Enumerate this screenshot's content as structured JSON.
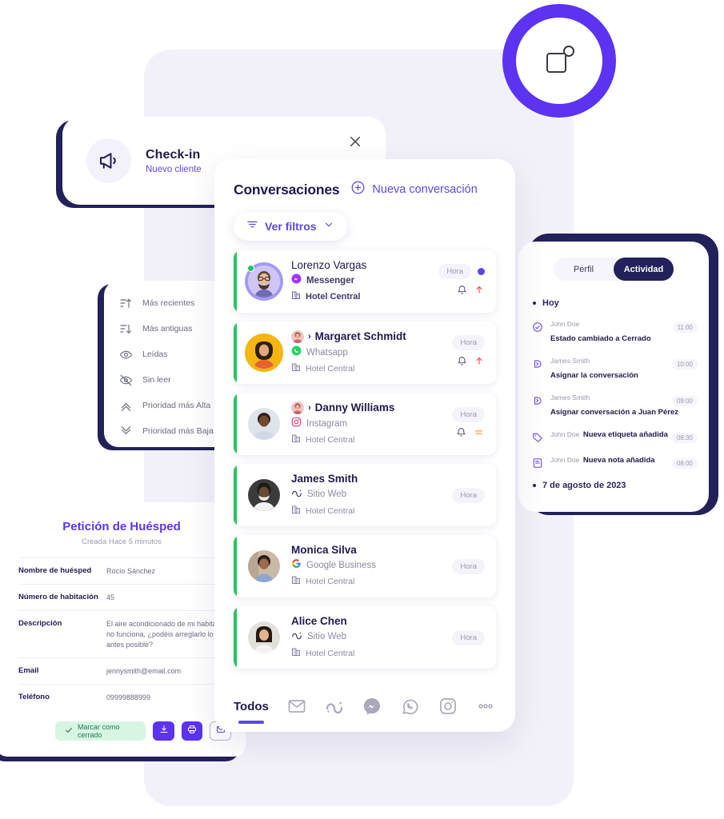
{
  "badge": {
    "icon": "notification-square-icon"
  },
  "checkin_card": {
    "icon": "megaphone-icon",
    "title": "Check-in",
    "subtitle": "Nuevo cliente"
  },
  "sort_menu": {
    "items": [
      {
        "icon": "sort-ascending-icon",
        "label": "Más recientes"
      },
      {
        "icon": "sort-descending-icon",
        "label": "Más antiguas"
      },
      {
        "icon": "eye-icon",
        "label": "Leídas"
      },
      {
        "icon": "eye-off-icon",
        "label": "Sin leer"
      },
      {
        "icon": "chevrons-up-icon",
        "label": "Prioridad más Alta"
      },
      {
        "icon": "chevrons-down-icon",
        "label": "Prioridad más Baja"
      }
    ]
  },
  "conversations_panel": {
    "title": "Conversaciones",
    "new_conversation": {
      "icon": "plus-circle-icon",
      "label": "Nueva conversación"
    },
    "filters_button": {
      "icon": "filter-icon",
      "label": "Ver filtros",
      "chevron": "chevron-down-icon"
    },
    "close_icon": "close-icon",
    "time_badge": "Hora",
    "items": [
      {
        "name": "Lorenzo Vargas",
        "channel": "Messenger",
        "channel_icon": "messenger-icon",
        "hotel": "Hotel Central",
        "hotel_icon": "building-icon",
        "time": "Hora",
        "unread": true,
        "online": true,
        "has_parent": false,
        "bold": true,
        "bell": "bell-icon",
        "priority": "high"
      },
      {
        "name": "Margaret Schmidt",
        "channel": "Whatsapp",
        "channel_icon": "whatsapp-icon",
        "hotel": "Hotel Central",
        "hotel_icon": "building-icon",
        "time": "Hora",
        "unread": false,
        "online": false,
        "has_parent": true,
        "bold": true,
        "bell": "bell-icon",
        "priority": "high"
      },
      {
        "name": "Danny Williams",
        "channel": "Instagram",
        "channel_icon": "instagram-icon",
        "hotel": "Hotel Central",
        "hotel_icon": "building-icon",
        "time": "Hora",
        "unread": false,
        "online": false,
        "has_parent": true,
        "bold": true,
        "bell": "bell-icon",
        "priority": "medium"
      },
      {
        "name": "James Smith",
        "channel": "Sitio Web",
        "channel_icon": "website-icon",
        "hotel": "Hotel Central",
        "hotel_icon": "building-icon",
        "time": "Hora",
        "unread": false,
        "online": false,
        "has_parent": false,
        "bold": true,
        "bell": "",
        "priority": "none"
      },
      {
        "name": "Monica Silva",
        "channel": "Google Business",
        "channel_icon": "google-icon",
        "hotel": "Hotel Central",
        "hotel_icon": "building-icon",
        "time": "Hora",
        "unread": false,
        "online": false,
        "has_parent": false,
        "bold": true,
        "bell": "",
        "priority": "none"
      },
      {
        "name": "Alice Chen",
        "channel": "Sitio Web",
        "channel_icon": "website-icon",
        "hotel": "Hotel Central",
        "hotel_icon": "building-icon",
        "time": "Hora",
        "unread": false,
        "online": false,
        "has_parent": false,
        "bold": true,
        "bell": "",
        "priority": "none"
      }
    ],
    "channel_bar": {
      "all_label": "Todos",
      "icons": [
        "email-icon",
        "website-icon",
        "messenger-icon",
        "whatsapp-icon",
        "instagram-icon",
        "more-icon"
      ]
    }
  },
  "activity_panel": {
    "tabs": [
      {
        "label": "Perfil",
        "active": false
      },
      {
        "label": "Actividad",
        "active": true
      }
    ],
    "today_label": "Hoy",
    "entries": [
      {
        "icon": "check-circle-icon",
        "user": "John Doe",
        "action": "Estado cambiado a Cerrado",
        "time": "11:00"
      },
      {
        "icon": "assign-icon",
        "user": "James Smith",
        "action": "Asignar la conversación",
        "time": "10:00"
      },
      {
        "icon": "assign-icon",
        "user": "James Smith",
        "action": "Asignar conversación a Juan Pérez",
        "time": "09:00"
      },
      {
        "icon": "tag-icon",
        "user": "John Doe",
        "action": "Nueva etiqueta añadida",
        "time": "08:30"
      },
      {
        "icon": "note-icon",
        "user": "John Doe",
        "action": "Nueva nota añadida",
        "time": "08:00"
      }
    ],
    "past_date_label": "7 de agosto de 2023"
  },
  "guest_request": {
    "title": "Petición de Huésped",
    "subtitle": "Creada Hace 5 minutos",
    "fields": [
      {
        "key": "Nombre de huésped",
        "value": "Rocío Sánchez"
      },
      {
        "key": "Número de habitación",
        "value": "45"
      },
      {
        "key": "Descripción",
        "value": "El aire acondicionado de mi habitación no funciona, ¿podéis arreglarlo lo antes posible?"
      },
      {
        "key": "Email",
        "value": "jennysmith@email.com"
      },
      {
        "key": "Teléfono",
        "value": "09999888999"
      }
    ],
    "close_button": {
      "icon": "check-icon",
      "label": "Marcar como cerrado"
    },
    "action_buttons": [
      "download-icon",
      "print-icon",
      "mail-icon"
    ]
  },
  "colors": {
    "accent": "#5b47e8",
    "accent_strong": "#5b33f0",
    "navy": "#1f1b4d",
    "panel_bg": "#f2f1f9",
    "green": "#22c55e",
    "priority_high": "#f0453a",
    "priority_medium": "#f5a623"
  }
}
